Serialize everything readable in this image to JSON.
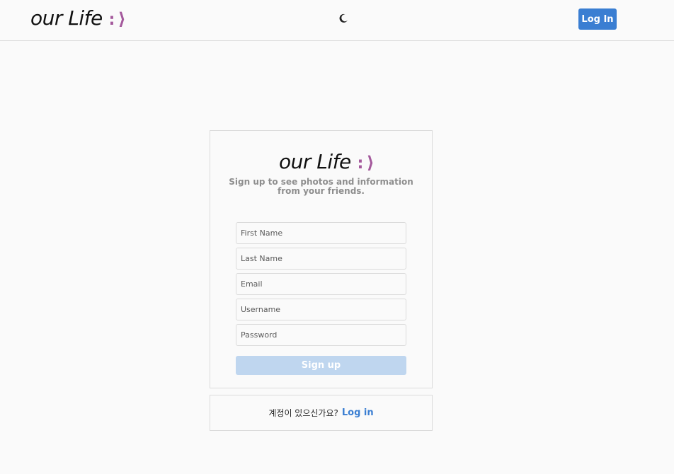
{
  "header": {
    "brand_word": "our Life",
    "brand_smile": ":⟩",
    "theme_icon": "moon-icon",
    "login_label": "Log In"
  },
  "signup_card": {
    "brand_word": "our Life",
    "brand_smile": ":⟩",
    "tagline": "Sign up to see photos and information from your friends.",
    "fields": [
      {
        "placeholder": "First Name",
        "value": ""
      },
      {
        "placeholder": "Last Name",
        "value": ""
      },
      {
        "placeholder": "Email",
        "value": ""
      },
      {
        "placeholder": "Username",
        "value": ""
      },
      {
        "placeholder": "Password",
        "value": ""
      }
    ],
    "signup_label": "Sign up"
  },
  "login_card": {
    "question": "계정이 있으신가요?",
    "login_link": "Log in"
  },
  "colors": {
    "accent": "#3a7ed2",
    "brand_smile": "#a4599c",
    "disabled_button": "#bfd6ef",
    "border": "#dbdbdb",
    "background": "#fafafa"
  }
}
